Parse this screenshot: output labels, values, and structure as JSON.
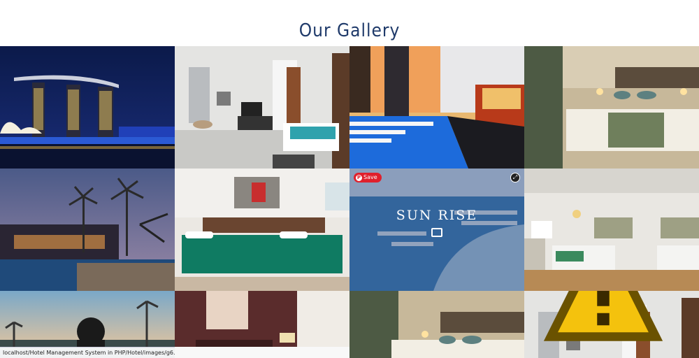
{
  "gallery": {
    "title": "Our Gallery"
  },
  "tiles": [
    {
      "name": "marina-bay-night",
      "alt": "Hotel skyline at night"
    },
    {
      "name": "modern-bedroom",
      "alt": "Modern bedroom"
    },
    {
      "name": "rooftop-pool",
      "alt": "Rooftop pool at dusk"
    },
    {
      "name": "standard-room",
      "alt": "Standard room"
    },
    {
      "name": "palm-resort",
      "alt": "Palm resort at evening"
    },
    {
      "name": "twin-room",
      "alt": "Twin room"
    },
    {
      "name": "sunrise-pool",
      "alt": "Infinity pool"
    },
    {
      "name": "suite-room",
      "alt": "Suite room"
    },
    {
      "name": "beach-sunset",
      "alt": "Beach sunset"
    },
    {
      "name": "lobby-room",
      "alt": "Room interior"
    },
    {
      "name": "standard-room-2",
      "alt": "Standard room"
    },
    {
      "name": "modern-bedroom-2",
      "alt": "Modern bedroom"
    }
  ],
  "hover_overlay": {
    "caption": "SUN RISE",
    "save_label": "Save",
    "image-icon": "image-icon",
    "expand-icon": "expand-icon"
  },
  "status_bar": {
    "url": "localhost/Hotel Management System in PHP/Hotel/images/g6.jpg"
  },
  "colors": {
    "title": "#1f3a6a",
    "overlay": "#1e376e",
    "save": "#e0202c"
  }
}
